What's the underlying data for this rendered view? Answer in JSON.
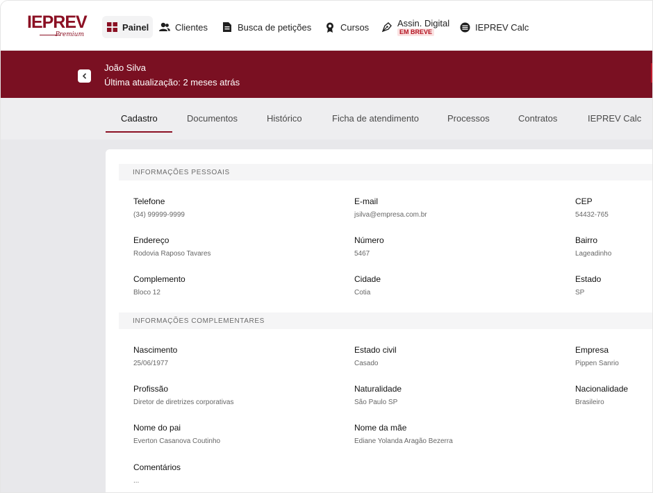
{
  "logo": {
    "text": "IEPREV",
    "sub": "Premium"
  },
  "nav": [
    {
      "label": "Painel",
      "icon": "grid-icon",
      "active": true
    },
    {
      "label": "Clientes",
      "icon": "users-icon"
    },
    {
      "label": "Busca de petições",
      "icon": "document-icon"
    },
    {
      "label": "Cursos",
      "icon": "award-icon"
    },
    {
      "label": "Assin. Digital",
      "icon": "signature-icon",
      "badge": "EM BREVE"
    },
    {
      "label": "IEPREV Calc",
      "icon": "database-icon"
    }
  ],
  "client": {
    "name": "João Silva",
    "updated": "Última atualização: 2 meses atrás"
  },
  "tabs": [
    "Cadastro",
    "Documentos",
    "Histórico",
    "Ficha de atendimento",
    "Processos",
    "Contratos",
    "IEPREV Calc"
  ],
  "sections": {
    "personal": "INFORMAÇÕES PESSOAIS",
    "complementary": "INFORMAÇÕES COMPLEMENTARES"
  },
  "personal_fields": [
    {
      "label": "Telefone",
      "value": "(34) 99999-9999"
    },
    {
      "label": "E-mail",
      "value": "jsilva@empresa.com.br"
    },
    {
      "label": "CEP",
      "value": "54432-765"
    },
    {
      "label": "Endereço",
      "value": "Rodovia Raposo Tavares"
    },
    {
      "label": "Número",
      "value": "5467"
    },
    {
      "label": "Bairro",
      "value": "Lageadinho"
    },
    {
      "label": "Complemento",
      "value": "Bloco 12"
    },
    {
      "label": "Cidade",
      "value": "Cotia"
    },
    {
      "label": "Estado",
      "value": "SP"
    }
  ],
  "complementary_fields": [
    {
      "label": "Nascimento",
      "value": "25/06/1977"
    },
    {
      "label": "Estado civil",
      "value": "Casado"
    },
    {
      "label": "Empresa",
      "value": "Pippen Sanrio"
    },
    {
      "label": "Profissão",
      "value": "Diretor de diretrizes corporativas"
    },
    {
      "label": "Naturalidade",
      "value": "São Paulo SP"
    },
    {
      "label": "Nacionalidade",
      "value": "Brasileiro"
    },
    {
      "label": "Nome do pai",
      "value": "Everton Casanova Coutinho"
    },
    {
      "label": "Nome da mãe",
      "value": "Ediane Yolanda Aragão Bezerra"
    },
    {
      "label": "Comentários",
      "value": "..."
    }
  ]
}
